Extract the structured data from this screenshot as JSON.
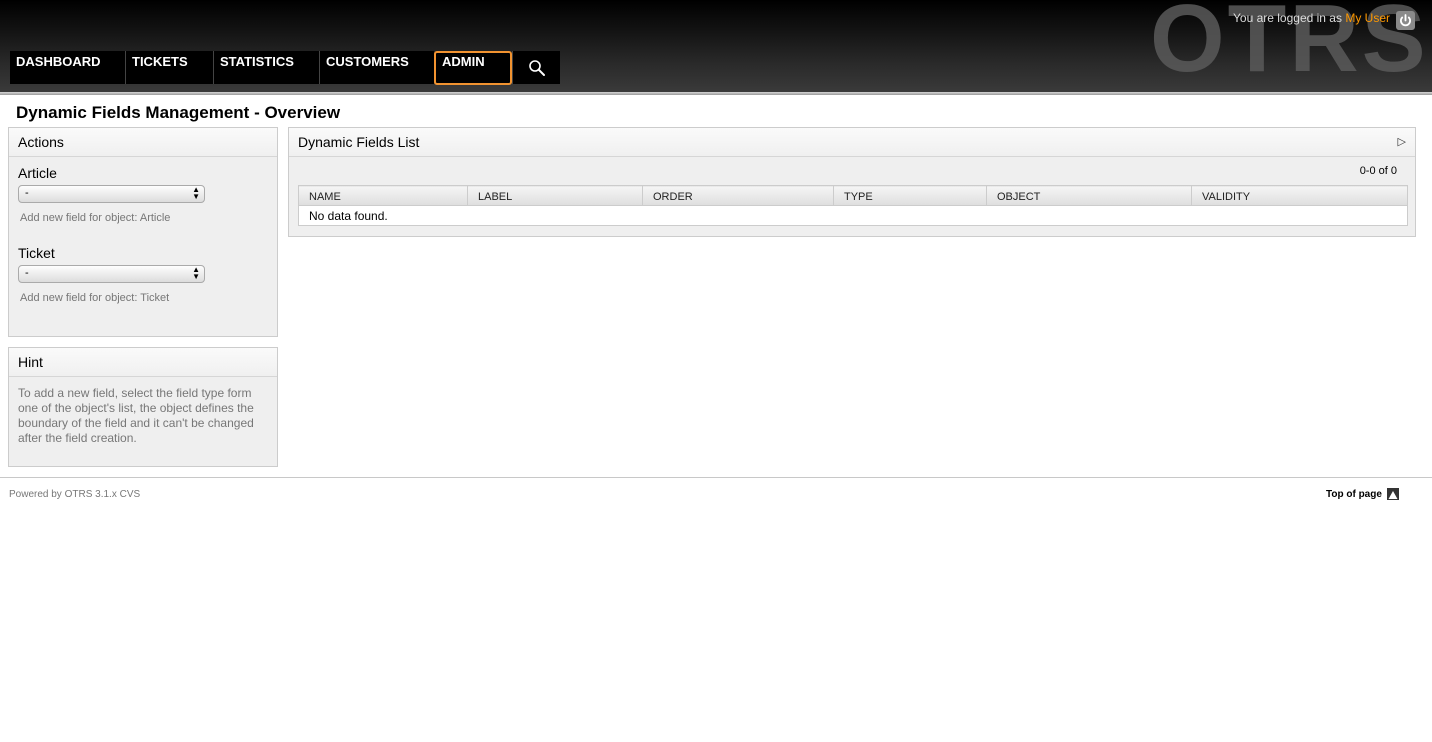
{
  "header": {
    "logo_text": "OTRS",
    "login_prefix": "You are logged in as",
    "user_name": "My User",
    "logout_icon": "power-icon"
  },
  "nav": {
    "items": [
      {
        "label": "DASHBOARD"
      },
      {
        "label": "TICKETS"
      },
      {
        "label": "STATISTICS"
      },
      {
        "label": "CUSTOMERS"
      },
      {
        "label": "ADMIN",
        "active": true
      }
    ],
    "search_icon": "search-icon"
  },
  "page_title": "Dynamic Fields Management - Overview",
  "actions": {
    "title": "Actions",
    "article_label": "Article",
    "article_select": "-",
    "article_hint": "Add new field for object: Article",
    "ticket_label": "Ticket",
    "ticket_select": "-",
    "ticket_hint": "Add new field for object: Ticket"
  },
  "hint": {
    "title": "Hint",
    "text": "To add a new field, select the field type form one of the object's list, the object defines the boundary of the field and it can't be changed after the field creation."
  },
  "list": {
    "title": "Dynamic Fields List",
    "pager": "0-0 of 0",
    "columns": [
      "NAME",
      "LABEL",
      "ORDER",
      "TYPE",
      "OBJECT",
      "VALIDITY"
    ],
    "empty_message": "No data found."
  },
  "footer": {
    "powered": "Powered by OTRS 3.1.x CVS",
    "top_link": "Top of page"
  },
  "colors": {
    "accent": "#f29330",
    "user_link": "#ff9900"
  }
}
